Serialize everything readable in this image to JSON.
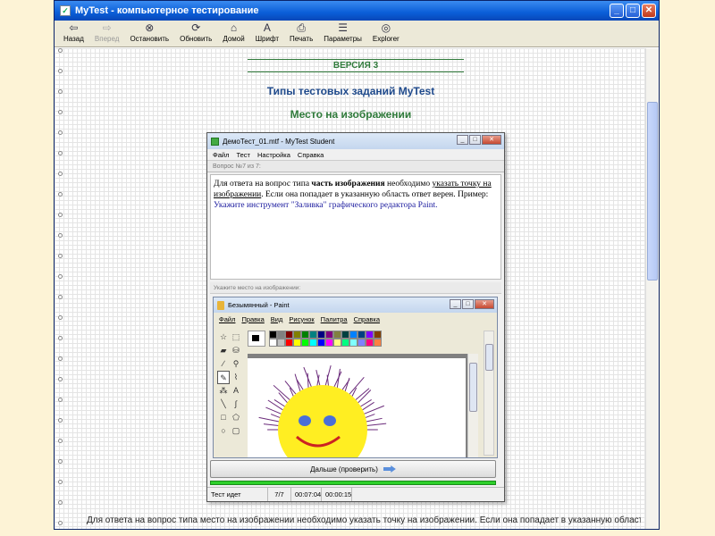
{
  "window": {
    "title": "MyTest - компьютерное тестирование",
    "controls": {
      "minimize": "_",
      "maximize": "□",
      "close": "✕"
    }
  },
  "toolbar": [
    {
      "label": "Назад",
      "icon": "back-arrow-icon",
      "glyph": "⇦",
      "enabled": true
    },
    {
      "label": "Вперед",
      "icon": "forward-arrow-icon",
      "glyph": "⇨",
      "enabled": false
    },
    {
      "label": "Остановить",
      "icon": "stop-icon",
      "glyph": "⊗",
      "enabled": true
    },
    {
      "label": "Обновить",
      "icon": "refresh-icon",
      "glyph": "⟳",
      "enabled": true
    },
    {
      "label": "Домой",
      "icon": "home-icon",
      "glyph": "⌂",
      "enabled": true
    },
    {
      "label": "Шрифт",
      "icon": "font-icon",
      "glyph": "A",
      "enabled": true
    },
    {
      "label": "Печать",
      "icon": "print-icon",
      "glyph": "⎙",
      "enabled": true
    },
    {
      "label": "Параметры",
      "icon": "options-icon",
      "glyph": "☰",
      "enabled": true
    },
    {
      "label": "Explorer",
      "icon": "explorer-icon",
      "glyph": "◎",
      "enabled": true
    }
  ],
  "page": {
    "version": "ВЕРСИЯ 3",
    "heading": "Типы тестовых заданий MyTest",
    "subheading": "Место на изображении",
    "bottom_text": "Для ответа на вопрос типа место на изображении необходимо указать точку на изображении. Если она попадает в указанную область"
  },
  "mytest": {
    "title": "ДемоТест_01.mtf - MyTest Student",
    "menu": [
      "Файл",
      "Тест",
      "Настройка",
      "Справка"
    ],
    "question_number": "Вопрос №7 из 7:",
    "question": {
      "p1": "Для ответа на вопрос типа ",
      "bold": "часть изображения",
      "p2": " необходимо ",
      "u1": "указать точку на изображении",
      "p3": ". Если она попадает в указанную область ответ верен. Пример: ",
      "example": "Укажите инструмент \"Заливка\" графического редактора Paint."
    },
    "area_label": "Укажите место на изображении:",
    "check_button": "Дальше (проверить)",
    "status": {
      "state": "Тест идет",
      "progress": "7/7",
      "time_total": "00:07:04",
      "time_question": "00:00:15"
    }
  },
  "paint": {
    "title": "Безымянный - Paint",
    "menu": [
      "Файл",
      "Правка",
      "Вид",
      "Рисунок",
      "Палитра",
      "Справка"
    ],
    "tools": [
      "free-select",
      "rect-select",
      "eraser",
      "fill",
      "eyedropper",
      "magnifier",
      "pencil",
      "brush",
      "airbrush",
      "text",
      "line",
      "curve",
      "rectangle",
      "polygon",
      "ellipse",
      "rounded-rect"
    ],
    "selected_tool": "pencil",
    "palette": [
      "#000000",
      "#808080",
      "#800000",
      "#808000",
      "#008000",
      "#008080",
      "#000080",
      "#800080",
      "#808040",
      "#004040",
      "#0080ff",
      "#004080",
      "#8000ff",
      "#804000",
      "#ffffff",
      "#c0c0c0",
      "#ff0000",
      "#ffff00",
      "#00ff00",
      "#00ffff",
      "#0000ff",
      "#ff00ff",
      "#ffff80",
      "#00ff80",
      "#80ffff",
      "#8080ff",
      "#ff0080",
      "#ff8040"
    ]
  },
  "colors": {
    "accent_green": "#2f7a3a",
    "heading_blue": "#1f4a8c",
    "sun_yellow": "#ffee22",
    "sun_eyes": "#4a6fd8",
    "sun_smile": "#cc2222",
    "sun_rays": "#6a2a7a"
  }
}
